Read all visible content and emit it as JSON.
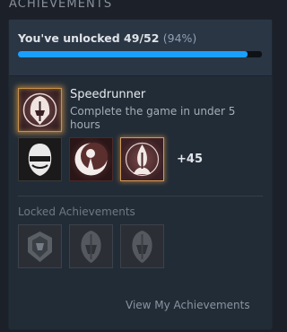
{
  "section": {
    "title": "ACHIEVEMENTS"
  },
  "progress": {
    "prefix": "You've unlocked",
    "count": "49/52",
    "percent_text": "(94%)",
    "fraction": 0.94,
    "bar_color": "#1a9fff"
  },
  "featured": {
    "icon": "hooded-figure-icon",
    "title": "Speedrunner",
    "description": "Complete the game in under 5 hours"
  },
  "recent": {
    "icons": [
      "masked-face-icon",
      "crescent-figure-icon",
      "flame-goddess-icon"
    ],
    "more_label": "+45"
  },
  "locked": {
    "title": "Locked Achievements",
    "icons": [
      "locked-crest-icon",
      "locked-mask-icon",
      "locked-mask-icon"
    ]
  },
  "footer": {
    "link_label": "View My Achievements"
  },
  "colors": {
    "background": "#1b2029",
    "panel": "#222c37",
    "accent_gold": "#c8924a"
  }
}
